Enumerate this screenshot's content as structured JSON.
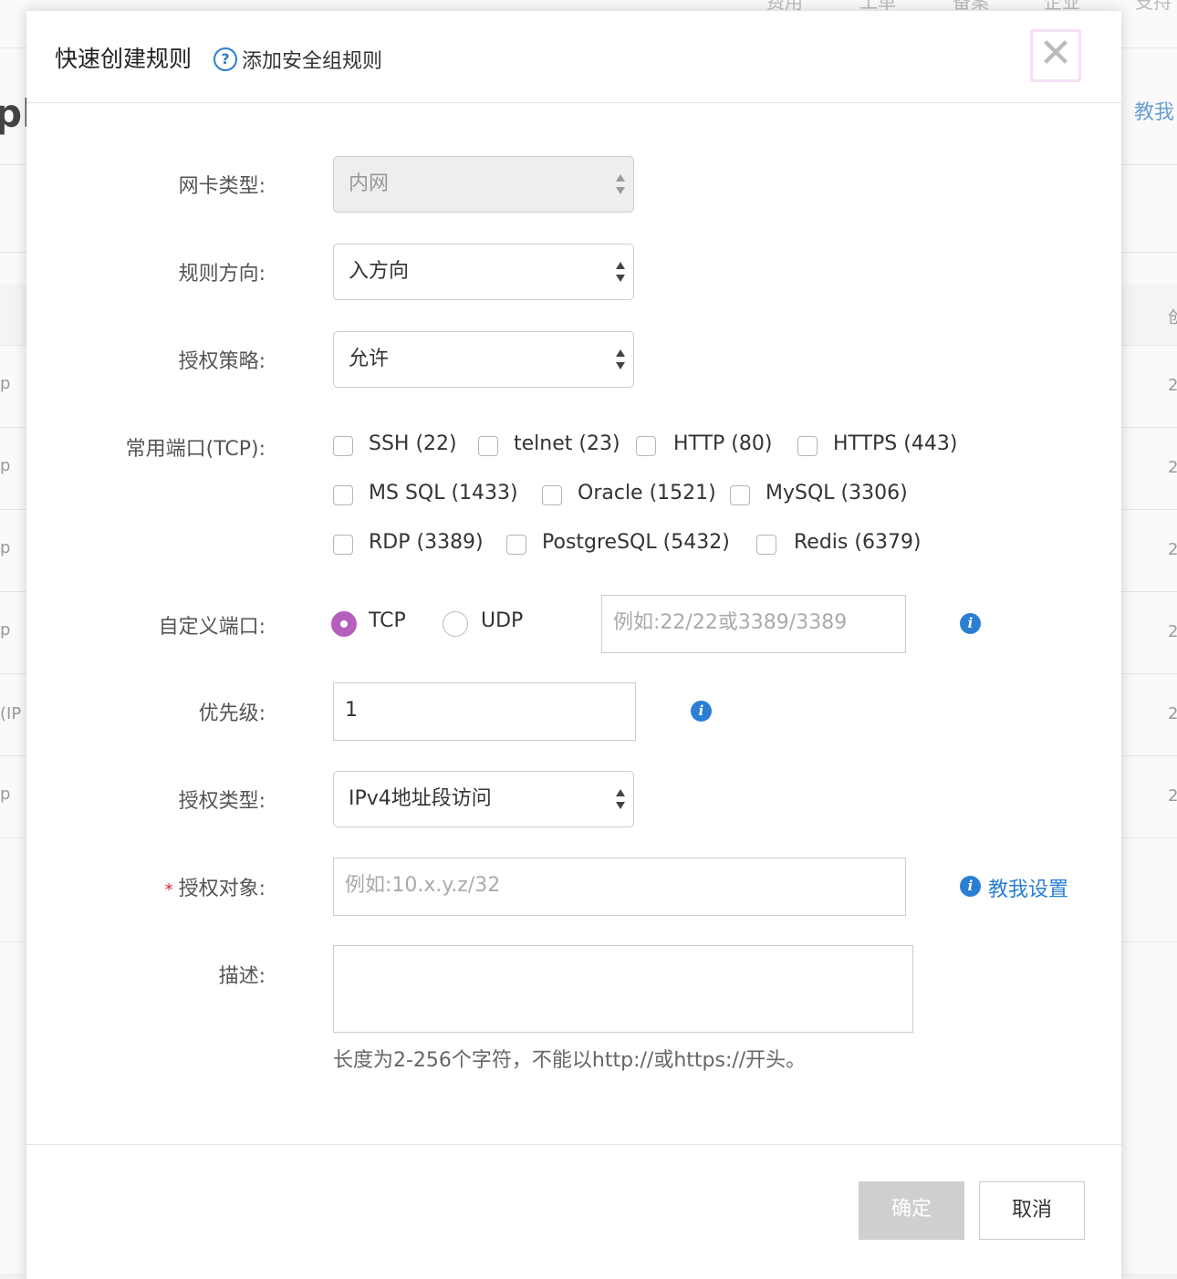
{
  "background": {
    "nav": [
      "费用",
      "工单",
      "备案",
      "企业",
      "支持"
    ],
    "partial_heading": "ph",
    "partial_link": "教我",
    "row_chars_right": [
      "2",
      "2",
      "2",
      "2",
      "2",
      "2"
    ],
    "row_chars_left": [
      "p",
      "p",
      "p",
      "p",
      "(IP",
      "p"
    ],
    "header_right_char": "创"
  },
  "dialog": {
    "title": "快速创建规则",
    "help_icon": "?",
    "help_link": "添加安全组规则",
    "close_symbol": "✕"
  },
  "form": {
    "nic_type": {
      "label": "网卡类型:",
      "value": "内网"
    },
    "direction": {
      "label": "规则方向:",
      "value": "入方向"
    },
    "policy": {
      "label": "授权策略:",
      "value": "允许"
    },
    "ports": {
      "label": "常用端口(TCP):",
      "options": [
        "SSH (22)",
        "telnet (23)",
        "HTTP (80)",
        "HTTPS (443)",
        "MS SQL (1433)",
        "Oracle (1521)",
        "MySQL (3306)",
        "RDP (3389)",
        "PostgreSQL (5432)",
        "Redis (6379)"
      ]
    },
    "custom_port": {
      "label": "自定义端口:",
      "tcp": "TCP",
      "udp": "UDP",
      "selected": "TCP",
      "placeholder": "例如:22/22或3389/3389"
    },
    "priority": {
      "label": "优先级:",
      "value": "1"
    },
    "auth_type": {
      "label": "授权类型:",
      "value": "IPv4地址段访问"
    },
    "auth_object": {
      "required_mark": "*",
      "label": "授权对象:",
      "placeholder": "例如:10.x.y.z/32",
      "teach_link": "教我设置"
    },
    "description": {
      "label": "描述:",
      "hint": "长度为2-256个字符，不能以http://或https://开头。"
    },
    "info_icon": "i"
  },
  "footer": {
    "ok": "确定",
    "cancel": "取消"
  },
  "colors": {
    "accent": "#2a7fd4",
    "radio": "#b65fbd",
    "required": "#d9232d",
    "disabled_button": "#cfcfcf"
  }
}
